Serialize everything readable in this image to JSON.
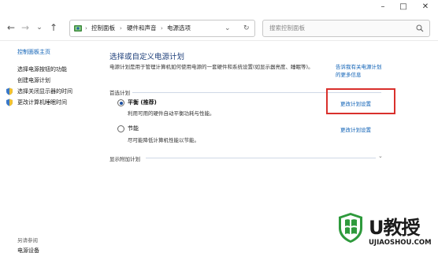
{
  "window": {
    "controls": {
      "minimize": "–",
      "maximize": "□",
      "close": "✕"
    }
  },
  "addressbar": {
    "back": "←",
    "forward": "→",
    "recent": "⌄",
    "up": "↑",
    "breadcrumbs": [
      "控制面板",
      "硬件和声音",
      "电源选项"
    ],
    "separator": "›",
    "dropdown": "⌄",
    "refresh": "↻",
    "search_placeholder": "搜索控制面板"
  },
  "sidebar": {
    "home_link": "控制面板主页",
    "links": [
      "选择电源按钮的功能",
      "创建电源计划",
      "选择关闭显示器的时间",
      "更改计算机睡眠时间"
    ],
    "see_also": "另请参阅",
    "see_also_item": "电源设备"
  },
  "main": {
    "title": "选择或自定义电源计划",
    "description": "电源计划是用于管理计算机如何使用电源的一套硬件和系统设置(如显示器亮度、睡眠等)。",
    "description_link": "告诉我有关电源计划的更多信息",
    "section_label": "首选计划",
    "plans": [
      {
        "name": "平衡 (推荐)",
        "description": "利用可用的硬件自动平衡功耗与性能。",
        "link": "更改计划设置",
        "selected": true
      },
      {
        "name": "节能",
        "description": "尽可能降低计算机性能以节能。",
        "link": "更改计划设置",
        "selected": false
      }
    ],
    "extra_label": "显示附加计划",
    "extra_chevron": "⌄"
  },
  "watermark": {
    "title": "U教授",
    "url": "UJIAOSHOU.COM"
  },
  "colors": {
    "link": "#0b5fb5",
    "title": "#1e3f7a",
    "highlight": "#d9302c",
    "watermark_green": "#2e9a3c"
  }
}
